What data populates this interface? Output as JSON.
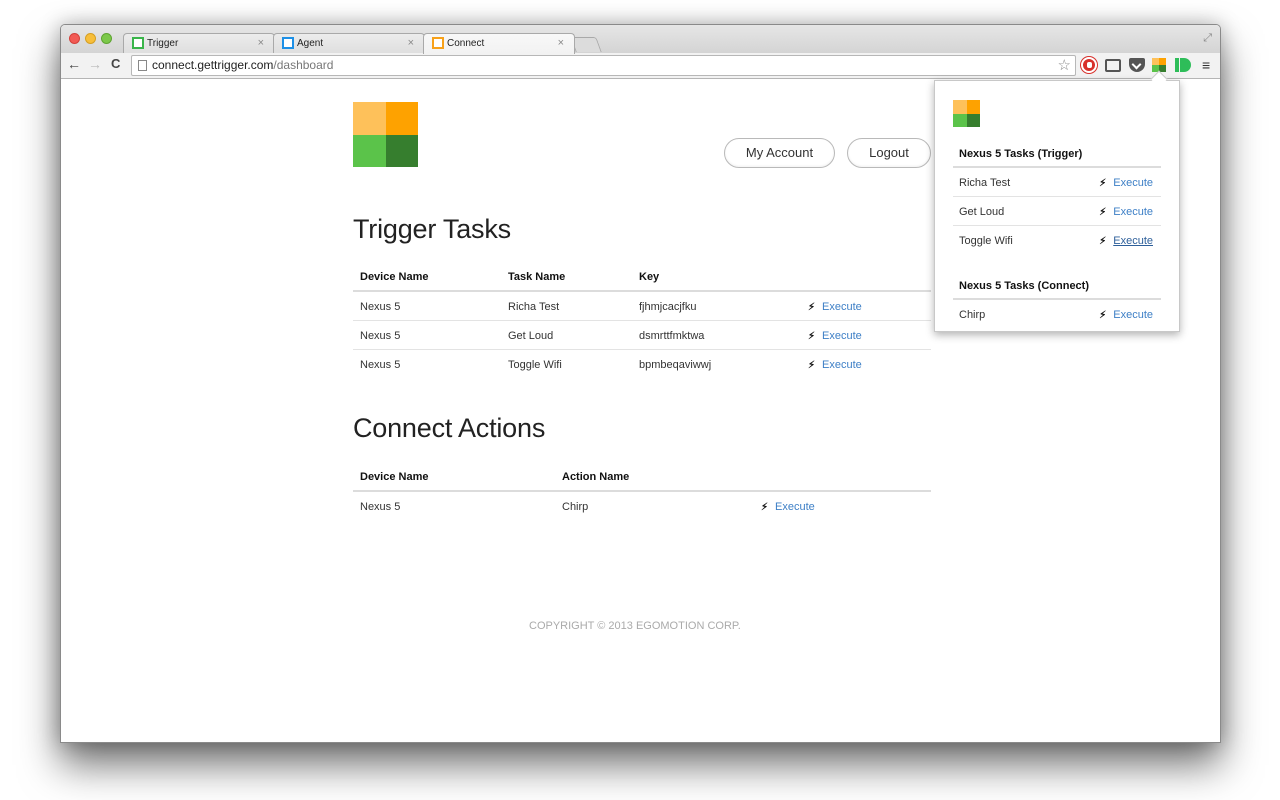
{
  "browser": {
    "tabs": [
      {
        "label": "Trigger",
        "favicon_color": "#3ab54a",
        "active": false
      },
      {
        "label": "Agent",
        "favicon_color": "#1e90e6",
        "active": false
      },
      {
        "label": "Connect",
        "favicon_color": "#f7a11a",
        "active": true
      }
    ],
    "tab_close_glyph": "×",
    "url_host": "connect.gettrigger.com",
    "url_path": "/dashboard",
    "nav": {
      "back": "←",
      "forward": "→",
      "reload": "C"
    },
    "star_glyph": "☆",
    "menu_glyph": "≡",
    "fullscreen_glyph": "⤢"
  },
  "header": {
    "logo_colors": [
      "#fec15a",
      "#fea200",
      "#5bc34a",
      "#367e2e"
    ],
    "my_account_label": "My Account",
    "logout_label": "Logout"
  },
  "trigger_tasks": {
    "title": "Trigger Tasks",
    "columns": [
      "Device Name",
      "Task Name",
      "Key"
    ],
    "rows": [
      {
        "device": "Nexus 5",
        "task": "Richa Test",
        "key": "fjhmjcacjfku",
        "action": "Execute"
      },
      {
        "device": "Nexus 5",
        "task": "Get Loud",
        "key": "dsmrttfmktwa",
        "action": "Execute"
      },
      {
        "device": "Nexus 5",
        "task": "Toggle Wifi",
        "key": "bpmbeqaviwwj",
        "action": "Execute"
      }
    ]
  },
  "connect_actions": {
    "title": "Connect Actions",
    "columns": [
      "Device Name",
      "Action Name"
    ],
    "rows": [
      {
        "device": "Nexus 5",
        "action_name": "Chirp",
        "action": "Execute"
      }
    ]
  },
  "footer": {
    "copyright": "COPYRIGHT © 2013 EGOMOTION CORP."
  },
  "popup": {
    "trigger_section": {
      "title": "Nexus 5 Tasks (Trigger)",
      "items": [
        {
          "name": "Richa Test",
          "action": "Execute"
        },
        {
          "name": "Get Loud",
          "action": "Execute"
        },
        {
          "name": "Toggle Wifi",
          "action": "Execute",
          "hovered": true
        }
      ]
    },
    "connect_section": {
      "title": "Nexus 5 Tasks (Connect)",
      "items": [
        {
          "name": "Chirp",
          "action": "Execute"
        }
      ]
    }
  },
  "icons": {
    "bolt": "⚡︎",
    "colors": {
      "link": "#3d7fc6",
      "adblock": "#d8302b",
      "idb": "#2ebd59"
    }
  }
}
